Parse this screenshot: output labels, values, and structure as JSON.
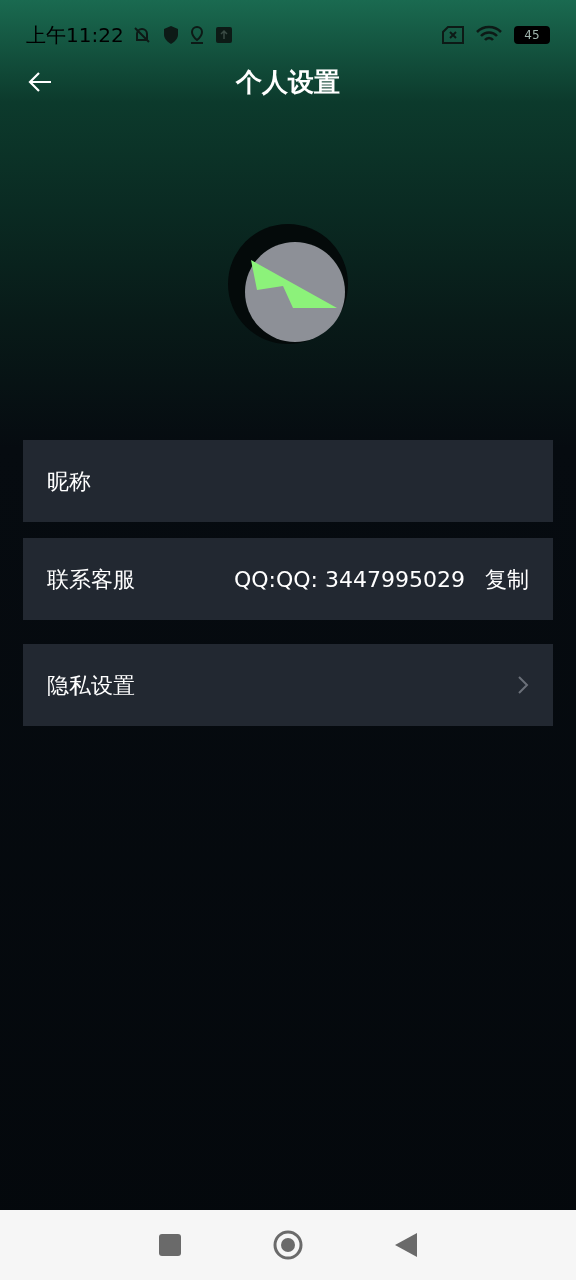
{
  "status_bar": {
    "time": "上午11:22",
    "battery": "45"
  },
  "header": {
    "title": "个人设置"
  },
  "rows": [
    {
      "kind": "plain",
      "label": "昵称"
    },
    {
      "kind": "contact",
      "label": "联系客服",
      "value": "QQ:QQ: 3447995029",
      "action": "复制"
    },
    {
      "kind": "link",
      "label": "隐私设置"
    }
  ]
}
